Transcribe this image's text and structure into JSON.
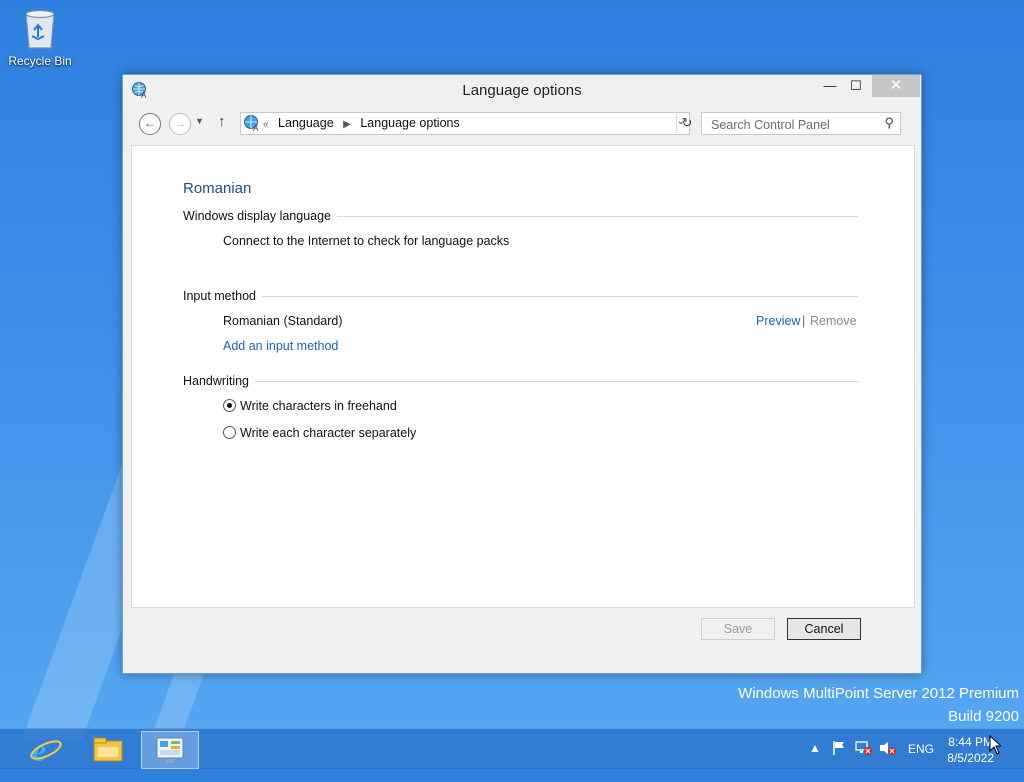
{
  "desktop": {
    "recycle_bin_label": "Recycle Bin",
    "watermark_line1": "Windows MultiPoint Server 2012 Premium",
    "watermark_line2": "Build 9200"
  },
  "window": {
    "title": "Language options",
    "controls": {
      "minimize": "—",
      "maximize": "☐",
      "close": "✕"
    }
  },
  "nav": {
    "overflow": "«",
    "breadcrumbs": [
      "Language",
      "Language options"
    ],
    "search_placeholder": "Search Control Panel"
  },
  "page": {
    "language_name": "Romanian",
    "display_section": {
      "title": "Windows display language",
      "message": "Connect to the Internet to check for language packs"
    },
    "input_section": {
      "title": "Input method",
      "method_name": "Romanian (Standard)",
      "preview_link": "Preview",
      "divider": "|",
      "remove_link": "Remove",
      "add_link": "Add an input method"
    },
    "handwriting_section": {
      "title": "Handwriting",
      "options": [
        {
          "label": "Write characters in freehand",
          "selected": true
        },
        {
          "label": "Write each character separately",
          "selected": false
        }
      ]
    },
    "buttons": {
      "save": "Save",
      "cancel": "Cancel"
    }
  },
  "taskbar": {
    "language": "ENG",
    "time": "8:44 PM",
    "date": "8/5/2022",
    "icons": [
      "internet-explorer-icon",
      "file-explorer-icon",
      "control-panel-icon"
    ]
  }
}
